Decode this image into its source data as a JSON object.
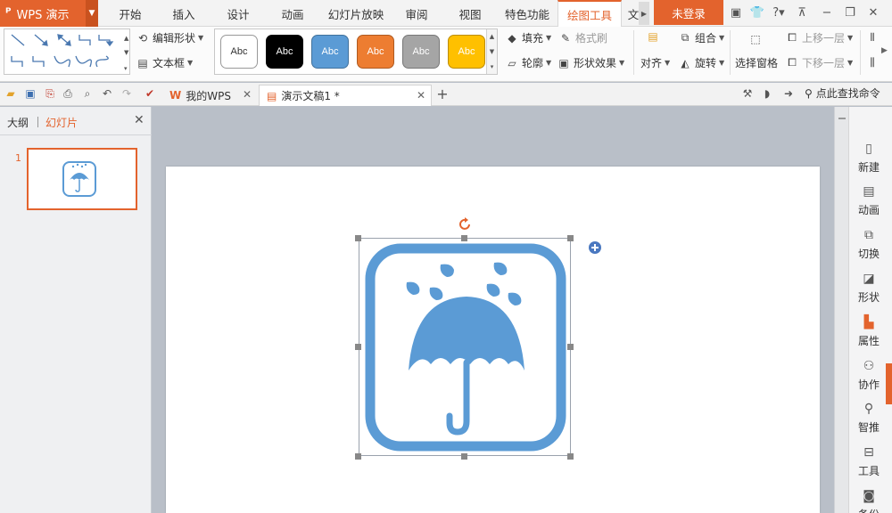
{
  "app": {
    "name": "WPS 演示"
  },
  "menu": {
    "tabs": [
      "开始",
      "插入",
      "设计",
      "动画",
      "幻灯片放映",
      "审阅",
      "视图",
      "特色功能",
      "绘图工具",
      "文"
    ],
    "active_tab": "绘图工具",
    "login_label": "未登录"
  },
  "ribbon": {
    "edit_shape": "编辑形状",
    "text_box": "文本框",
    "style_label": "Abc",
    "style_colors": [
      "#ffffff",
      "#000000",
      "#5b9bd5",
      "#ed7d31",
      "#a5a5a5",
      "#ffc000"
    ],
    "fill": "填充",
    "format_painter": "格式刷",
    "outline": "轮廓",
    "shape_effect": "形状效果",
    "align": "对齐",
    "group": "组合",
    "rotate": "旋转",
    "selection_pane": "选择窗格",
    "bring_forward": "上移一层",
    "send_backward": "下移一层"
  },
  "tabbar": {
    "docs": [
      {
        "title": "我的WPS",
        "active": false
      },
      {
        "title": "演示文稿1 *",
        "active": true
      }
    ],
    "new_tab": "+",
    "find_command": "点此查找命令"
  },
  "left_panel": {
    "tab_outline": "大纲",
    "tab_slides": "幻灯片",
    "slide_number": "1"
  },
  "right_bar": {
    "items": [
      "新建",
      "动画",
      "切换",
      "形状",
      "属性",
      "协作",
      "智推",
      "工具",
      "备份"
    ]
  },
  "colors": {
    "accent": "#e3632d",
    "icon_blue": "#5b9bd5"
  }
}
